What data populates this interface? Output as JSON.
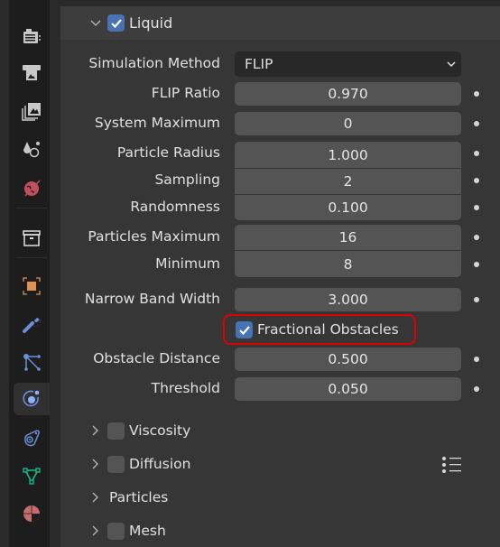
{
  "sidebar": {
    "tabs": [
      {
        "icon": "render-properties-icon",
        "color": "#c8c8c8"
      },
      {
        "icon": "output-properties-icon",
        "color": "#c8c8c8"
      },
      {
        "icon": "view-layer-properties-icon",
        "color": "#c8c8c8"
      },
      {
        "icon": "scene-properties-icon",
        "color": "#c8c8c8"
      },
      {
        "icon": "world-properties-icon",
        "color": "#c2505c"
      },
      {
        "icon": "collection-properties-icon",
        "color": "#e0e0e0"
      },
      {
        "icon": "object-properties-icon",
        "color": "#e09050"
      },
      {
        "icon": "modifier-properties-icon",
        "color": "#6b8fd6"
      },
      {
        "icon": "particle-properties-icon",
        "color": "#6b8fd6"
      },
      {
        "icon": "physics-properties-icon",
        "color": "#6b8fd6",
        "active": true
      },
      {
        "icon": "constraint-properties-icon",
        "color": "#6b8fd6"
      },
      {
        "icon": "data-properties-icon",
        "color": "#10c090"
      },
      {
        "icon": "material-properties-icon",
        "color": "#c76b6b"
      }
    ]
  },
  "panel": {
    "title": "Liquid",
    "enabled": true,
    "simulation_method": {
      "label": "Simulation Method",
      "value": "FLIP"
    },
    "fields": [
      {
        "label": "FLIP Ratio",
        "value": "0.970"
      },
      {
        "label": "System Maximum",
        "value": "0"
      },
      {
        "label": "Particle Radius",
        "value": "1.000"
      },
      {
        "label": "Sampling",
        "value": "2"
      },
      {
        "label": "Randomness",
        "value": "0.100"
      },
      {
        "label": "Particles Maximum",
        "value": "16"
      },
      {
        "label": "Minimum",
        "value": "8"
      },
      {
        "label": "Narrow Band Width",
        "value": "3.000"
      }
    ],
    "fractional_obstacles": {
      "label": "Fractional Obstacles",
      "checked": true
    },
    "obstacle_fields": [
      {
        "label": "Obstacle Distance",
        "value": "0.500"
      },
      {
        "label": "Threshold",
        "value": "0.050"
      }
    ],
    "subpanels": [
      {
        "label": "Viscosity",
        "has_checkbox": true,
        "checked": false
      },
      {
        "label": "Diffusion",
        "has_checkbox": true,
        "checked": false,
        "presets_icon": "presets-list-icon"
      },
      {
        "label": "Particles",
        "has_checkbox": false
      },
      {
        "label": "Mesh",
        "has_checkbox": true,
        "checked": false
      }
    ]
  },
  "colors": {
    "accent": "#4772b3",
    "highlight": "#e00000"
  }
}
